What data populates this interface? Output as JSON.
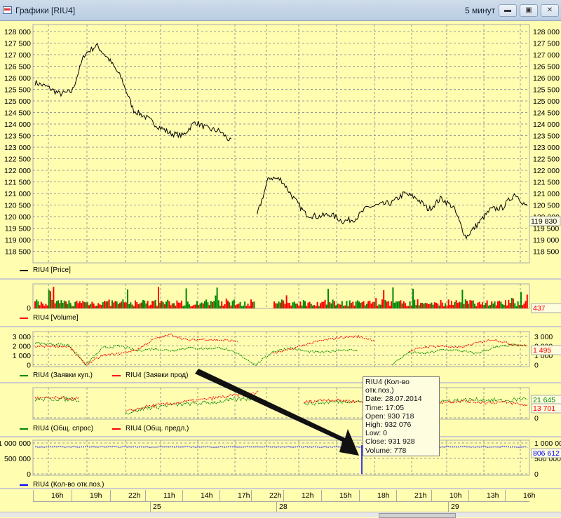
{
  "window": {
    "title": "Графики [RIU4]",
    "interval": "5 минут",
    "minimize": "▬",
    "maximize": "▣",
    "close": "✕"
  },
  "colors": {
    "background": "#fffdb0",
    "price": "#000000",
    "buy": "#008000",
    "sell": "#ff0000",
    "oi": "#0000ff"
  },
  "panes": {
    "price": {
      "legend": "RIU4 [Price]",
      "ticks": [
        "128 000",
        "127 500",
        "127 000",
        "126 500",
        "126 000",
        "125 500",
        "125 000",
        "124 500",
        "124 000",
        "123 500",
        "123 000",
        "122 500",
        "122 000",
        "121 500",
        "121 000",
        "120 500",
        "120 000",
        "119 500",
        "119 000",
        "118 500"
      ],
      "last": "119 830"
    },
    "volume": {
      "legend": "RIU4 [Volume]",
      "tick0": "0",
      "last": "437"
    },
    "orders": {
      "legend_buy": "RIU4 (Заявки куп.)",
      "legend_sell": "RIU4 (Заявки прод)",
      "ticks": [
        "3 000",
        "2 000",
        "1 000",
        "0"
      ],
      "last": "1 495"
    },
    "demand": {
      "legend_buy": "RIU4 (Общ. спрос)",
      "legend_sell": "RIU4 (Общ. предл.)",
      "tick0": "0",
      "last_buy": "21 645",
      "last_sell": "13 701"
    },
    "oi": {
      "legend": "RIU4 (Кол-во отк.поз.)",
      "ticks": [
        "1 000 000",
        "500 000",
        "0"
      ],
      "last": "806 612"
    }
  },
  "tooltip": {
    "title": "RIU4 (Кол-во отк.поз.)",
    "date": "Date: 28.07.2014",
    "time": "Time: 17:05",
    "open": "Open:  930 718",
    "high": "High:   932 076",
    "low": "Low:    0",
    "close": "Close: 931 928",
    "volume": "Volume: 778"
  },
  "timeaxis": {
    "hours": [
      "16h",
      "19h",
      "22h",
      "11h",
      "14h",
      "17h",
      "22h",
      "12h",
      "15h",
      "18h",
      "21h",
      "10h",
      "13h",
      "16h"
    ],
    "days": [
      "25",
      "28",
      "29"
    ]
  },
  "chart_data": {
    "type": "line",
    "title": "RIU4 5 min",
    "ylim": [
      118500,
      128000
    ],
    "price_keypoints": [
      125800,
      125600,
      125300,
      125400,
      127000,
      127400,
      126800,
      126000,
      124600,
      124300,
      123900,
      123600,
      123500,
      124100,
      123800,
      123700,
      123200,
      null,
      120000,
      121700,
      121600,
      120800,
      120100,
      120000,
      120100,
      119800,
      119900,
      120400,
      120500,
      120600,
      121000,
      120800,
      120300,
      120800,
      120400,
      119100,
      119700,
      120300,
      120400,
      121000,
      120400
    ],
    "orders_buy_keypoints": [
      2300,
      2200,
      2100,
      0,
      1800,
      2000,
      1500,
      1700,
      1500,
      1800,
      1700,
      1800,
      1100,
      0,
      1400,
      1800,
      1400,
      1300,
      1600,
      1500,
      null,
      0,
      1300,
      1200,
      1600,
      1500,
      1200,
      1800,
      2100,
      2000
    ],
    "orders_sell_keypoints": [
      1900,
      2000,
      1900,
      0,
      1000,
      1200,
      1600,
      2700,
      3200,
      2600,
      2700,
      2600,
      2500,
      null,
      1200,
      1600,
      2200,
      2600,
      2900,
      3000,
      2600,
      null,
      1400,
      1900,
      2000,
      1800,
      2300,
      2700,
      2200,
      2000
    ],
    "oi_level": 870000
  }
}
